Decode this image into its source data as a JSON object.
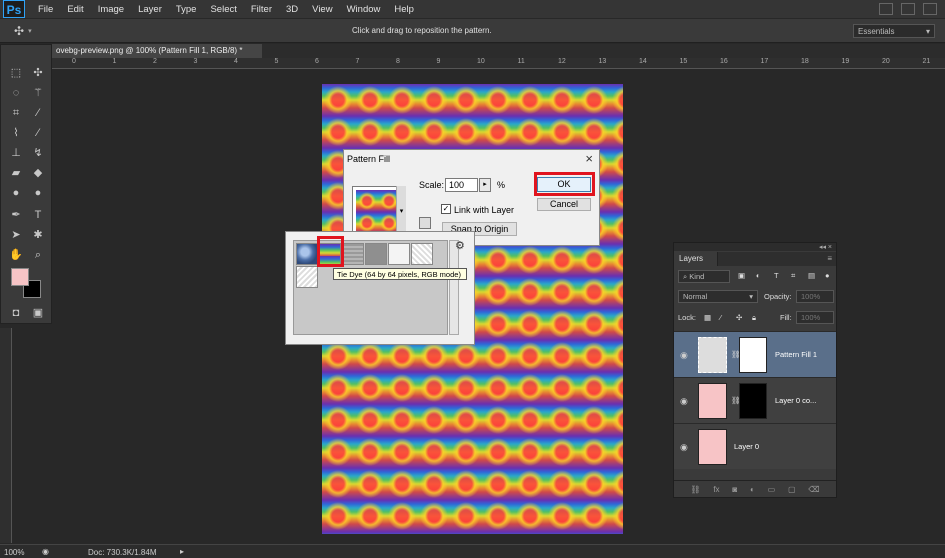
{
  "app": {
    "logo": "Ps"
  },
  "menu": [
    "File",
    "Edit",
    "Image",
    "Layer",
    "Type",
    "Select",
    "Filter",
    "3D",
    "View",
    "Window",
    "Help"
  ],
  "options_bar": {
    "hint": "Click and drag to reposition the pattern.",
    "workspace": "Essentials"
  },
  "document": {
    "tab_title": "ovebg-preview.png @ 100% (Pattern Fill 1, RGB/8) *"
  },
  "ruler": {
    "ticks": [
      "0",
      "1",
      "2",
      "3",
      "4",
      "5",
      "6",
      "7",
      "8",
      "9",
      "10",
      "11",
      "12",
      "13",
      "14",
      "15",
      "16",
      "17",
      "18",
      "19",
      "20",
      "21"
    ]
  },
  "status": {
    "zoom": "100%",
    "doc": "Doc: 730.3K/1.84M"
  },
  "dialog": {
    "title": "Pattern Fill",
    "scale_label": "Scale:",
    "scale_value": "100",
    "scale_unit": "%",
    "link_label": "Link with Layer",
    "snap_label": "Snap to Origin",
    "ok_label": "OK",
    "cancel_label": "Cancel"
  },
  "picker": {
    "tooltip": "Tie Dye (64 by 64 pixels, RGB mode)"
  },
  "colors": {
    "foreground": "#f7c4c6",
    "background": "#000000",
    "highlight": "#e0141e",
    "selected_layer": "#5a6f8a"
  },
  "layers_panel": {
    "title": "Layers",
    "kind": "Kind",
    "blend_mode": "Normal",
    "opacity_label": "Opacity:",
    "opacity_value": "100%",
    "lock_label": "Lock:",
    "fill_label": "Fill:",
    "fill_value": "100%",
    "layers": [
      {
        "name": "Pattern Fill 1",
        "selected": true
      },
      {
        "name": "Layer 0 co...",
        "selected": false
      },
      {
        "name": "Layer 0",
        "selected": false
      }
    ],
    "bottom_icons": [
      "link-icon",
      "fx-icon",
      "mask-icon",
      "adjustment-icon",
      "folder-icon",
      "new-layer-icon",
      "trash-icon"
    ]
  }
}
